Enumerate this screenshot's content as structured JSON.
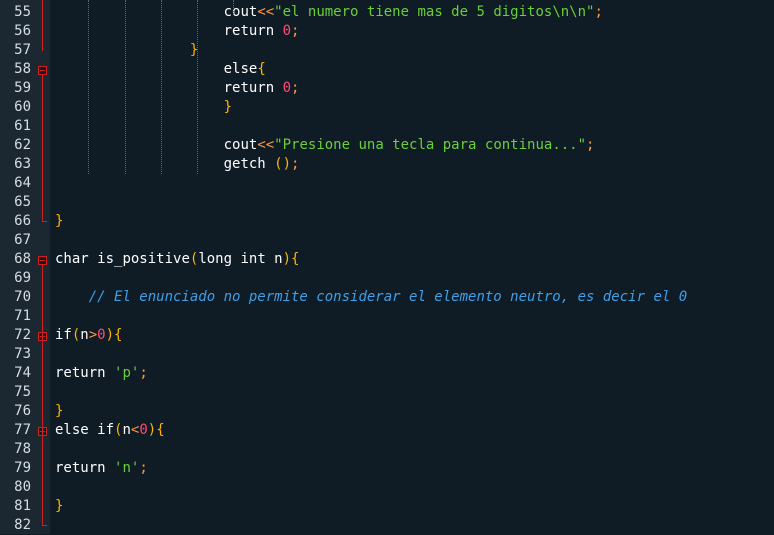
{
  "editor": {
    "lines": [
      {
        "n": "55",
        "indent": 20,
        "tokens": [
          {
            "t": "cout",
            "c": "fn"
          },
          {
            "t": "<<",
            "c": "op"
          },
          {
            "t": "\"el numero tiene mas de 5 digitos\\n\\n\"",
            "c": "str"
          },
          {
            "t": ";",
            "c": "op"
          }
        ]
      },
      {
        "n": "56",
        "indent": 20,
        "tokens": [
          {
            "t": "return ",
            "c": "kw"
          },
          {
            "t": "0",
            "c": "num"
          },
          {
            "t": ";",
            "c": "op"
          }
        ]
      },
      {
        "n": "57",
        "indent": 16,
        "tokens": [
          {
            "t": "}",
            "c": "br"
          }
        ]
      },
      {
        "n": "58",
        "indent": 20,
        "tokens": [
          {
            "t": "else",
            "c": "kw"
          },
          {
            "t": "{",
            "c": "br"
          }
        ]
      },
      {
        "n": "59",
        "indent": 20,
        "tokens": [
          {
            "t": "return ",
            "c": "kw"
          },
          {
            "t": "0",
            "c": "num"
          },
          {
            "t": ";",
            "c": "op"
          }
        ]
      },
      {
        "n": "60",
        "indent": 20,
        "tokens": [
          {
            "t": "}",
            "c": "br"
          }
        ]
      },
      {
        "n": "61",
        "indent": 0,
        "tokens": []
      },
      {
        "n": "62",
        "indent": 20,
        "tokens": [
          {
            "t": "cout",
            "c": "fn"
          },
          {
            "t": "<<",
            "c": "op"
          },
          {
            "t": "\"Presione una tecla para continua...\"",
            "c": "str"
          },
          {
            "t": ";",
            "c": "op"
          }
        ]
      },
      {
        "n": "63",
        "indent": 20,
        "tokens": [
          {
            "t": "getch ",
            "c": "fn"
          },
          {
            "t": "()",
            "c": "br"
          },
          {
            "t": ";",
            "c": "op"
          }
        ]
      },
      {
        "n": "64",
        "indent": 0,
        "tokens": []
      },
      {
        "n": "65",
        "indent": 0,
        "tokens": []
      },
      {
        "n": "66",
        "indent": 0,
        "tokens": [
          {
            "t": "}",
            "c": "br"
          }
        ]
      },
      {
        "n": "67",
        "indent": 0,
        "tokens": []
      },
      {
        "n": "68",
        "indent": 0,
        "tokens": [
          {
            "t": "char ",
            "c": "kw"
          },
          {
            "t": "is_positive",
            "c": "fn"
          },
          {
            "t": "(",
            "c": "br"
          },
          {
            "t": "long int n",
            "c": "kw"
          },
          {
            "t": "){",
            "c": "br"
          }
        ]
      },
      {
        "n": "69",
        "indent": 0,
        "tokens": []
      },
      {
        "n": "70",
        "indent": 4,
        "tokens": [
          {
            "t": "// El enunciado no permite considerar el elemento neutro, es decir el 0",
            "c": "cm"
          }
        ]
      },
      {
        "n": "71",
        "indent": 0,
        "tokens": []
      },
      {
        "n": "72",
        "indent": 0,
        "tokens": [
          {
            "t": "if",
            "c": "kw"
          },
          {
            "t": "(",
            "c": "br"
          },
          {
            "t": "n",
            "c": "kw"
          },
          {
            "t": ">",
            "c": "op"
          },
          {
            "t": "0",
            "c": "num"
          },
          {
            "t": "){",
            "c": "br"
          }
        ]
      },
      {
        "n": "73",
        "indent": 0,
        "tokens": []
      },
      {
        "n": "74",
        "indent": 0,
        "tokens": [
          {
            "t": "return ",
            "c": "kw"
          },
          {
            "t": "'p'",
            "c": "str"
          },
          {
            "t": ";",
            "c": "op"
          }
        ]
      },
      {
        "n": "75",
        "indent": 0,
        "tokens": []
      },
      {
        "n": "76",
        "indent": 0,
        "tokens": [
          {
            "t": "}",
            "c": "br"
          }
        ]
      },
      {
        "n": "77",
        "indent": 0,
        "tokens": [
          {
            "t": "else if",
            "c": "kw"
          },
          {
            "t": "(",
            "c": "br"
          },
          {
            "t": "n",
            "c": "kw"
          },
          {
            "t": "<",
            "c": "op"
          },
          {
            "t": "0",
            "c": "num"
          },
          {
            "t": "){",
            "c": "br"
          }
        ]
      },
      {
        "n": "78",
        "indent": 0,
        "tokens": []
      },
      {
        "n": "79",
        "indent": 0,
        "tokens": [
          {
            "t": "return ",
            "c": "kw"
          },
          {
            "t": "'n'",
            "c": "str"
          },
          {
            "t": ";",
            "c": "op"
          }
        ]
      },
      {
        "n": "80",
        "indent": 0,
        "tokens": []
      },
      {
        "n": "81",
        "indent": 0,
        "tokens": [
          {
            "t": "}",
            "c": "br"
          }
        ]
      },
      {
        "n": "82",
        "indent": 0,
        "tokens": []
      }
    ],
    "fold_markers": [
      "58",
      "68",
      "72",
      "77"
    ]
  }
}
